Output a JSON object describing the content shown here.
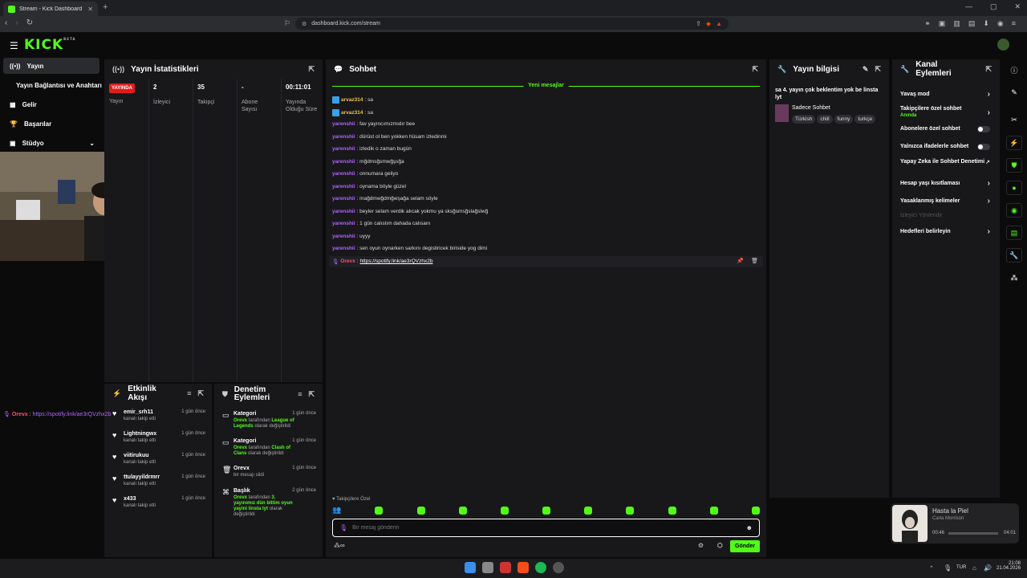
{
  "browser": {
    "tab_title": "Stream - Kick Dashboard",
    "url": "dashboard.kick.com/stream"
  },
  "brand": {
    "logo": "KICK",
    "badge": "BETA",
    "accent": "#53fc18"
  },
  "nav": {
    "items": [
      {
        "label": "Yayın",
        "icon": "broadcast-icon"
      },
      {
        "label": "Yayın Bağlantısı ve Anahtarı",
        "icon": ""
      },
      {
        "label": "Gelir",
        "icon": "revenue-icon"
      },
      {
        "label": "Başarılar",
        "icon": "trophy-icon"
      },
      {
        "label": "Stüdyo",
        "icon": "studio-icon"
      }
    ]
  },
  "stats": {
    "title": "Yayın İstatistikleri",
    "badge": "YAYINDA",
    "cols": [
      {
        "value": "",
        "label": "Yayın"
      },
      {
        "value": "2",
        "label": "İzleyici"
      },
      {
        "value": "35",
        "label": "Takipçi"
      },
      {
        "value": "-",
        "label": "Abone Sayısı"
      },
      {
        "value": "00:11:01",
        "label": "Yayında Olduğu Süre"
      }
    ]
  },
  "chat": {
    "title": "Sohbet",
    "new_messages": "Yeni mesajlar",
    "messages": [
      {
        "user": "arvaz314",
        "text": ": sa"
      },
      {
        "user": "arvaz314",
        "text": ": sa"
      },
      {
        "user": "yarenshii",
        "text": ": fav yayıncımızmıdır bee"
      },
      {
        "user": "yarenshii",
        "text": ": dürüst ol ben yokken hüsam izledinmi"
      },
      {
        "user": "yarenshii",
        "text": ": izledik o zaman bugün"
      },
      {
        "user": "yarenshii",
        "text": ": mğdmsğsmwğşsğa"
      },
      {
        "user": "yarenshii",
        "text": ": onnumara geliyo"
      },
      {
        "user": "yarenshii",
        "text": ": oynama böyle güzel"
      },
      {
        "user": "yarenshii",
        "text": ": mağdmwğdmğwşağa selam söyle"
      },
      {
        "user": "yarenshii",
        "text": ": beyler selam verdik alıcak yokmu ya sksğsmsğslağslwğ"
      },
      {
        "user": "yarenshii",
        "text": ": 1 gün calıstım dahada calısanı"
      },
      {
        "user": "yarenshii",
        "text": ": uyyy"
      },
      {
        "user": "yarenshii",
        "text": ": sen oyun oynarken sarkını degistiricek biriside yog dimi"
      },
      {
        "user": "Orevx",
        "text": ": ",
        "link": "https://spotify.link/ae3rQVzhx2b"
      }
    ],
    "followers_only": "Takipçilere Özel",
    "input_placeholder": "Bir mesaj gönderin",
    "send": "Gönder"
  },
  "info": {
    "title": "Yayın bilgisi",
    "stream_title": "sa 4. yayın çok beklentim yok be linsta lyt",
    "category": "Sadece Sohbet",
    "tags": [
      "Türkish",
      "chill",
      "funny",
      "turkçe"
    ]
  },
  "actions": {
    "title": "Kanal Eylemleri",
    "items": [
      {
        "label": "Yavaş mod"
      },
      {
        "label": "Takipçilere özel sohbet",
        "sub": "Anında"
      },
      {
        "label": "Abonelere özel sohbet"
      },
      {
        "label": "Yalnızca ifadelerle sohbet"
      },
      {
        "label": "Yapay Zeka ile Sohbet Denetimi"
      },
      {
        "label": "Hesap yaşı kısıtlaması"
      },
      {
        "label": "Yasaklanmış kelimeler"
      },
      {
        "label": "İzleyici Yönlendir"
      },
      {
        "label": "Hedefleri belirleyin"
      }
    ]
  },
  "activity": {
    "title": "Etkinlik Akışı",
    "items": [
      {
        "name": "emir_srh11",
        "sub": "kanalı takip etti",
        "time": "1 gün önce"
      },
      {
        "name": "Lightningwx",
        "sub": "kanalı takip etti",
        "time": "1 gün önce"
      },
      {
        "name": "viitirukuu",
        "sub": "kanalı takip etti",
        "time": "1 gün önce"
      },
      {
        "name": "ttulayyildrmrr",
        "sub": "kanalı takip etti",
        "time": "1 gün önce"
      },
      {
        "name": "x433",
        "sub": "kanalı takip etti",
        "time": "1 gün önce"
      }
    ]
  },
  "moderation": {
    "title": "Denetim Eylemleri",
    "items": [
      {
        "name": "Kategori",
        "actor": "Orevx",
        "mid": " tarafından ",
        "target": "League of Legends",
        "tail": " olarak değiştirildi",
        "time": "1 gün önce"
      },
      {
        "name": "Kategori",
        "actor": "Orevx",
        "mid": " tarafından ",
        "target": "Clash of Clans",
        "tail": " olarak değiştirildi",
        "time": "1 gün önce"
      },
      {
        "name": "Orevx",
        "actor": "",
        "mid": "bir mesajı sildi",
        "target": "",
        "tail": "",
        "time": "1 gün önce"
      },
      {
        "name": "Başlık",
        "actor": "Orevx",
        "mid": " tarafından ",
        "target": "3. yayınımız dün bittim oyun yayini linsta lyt",
        "tail": " olarak değiştirildi",
        "time": "2 gün önce"
      }
    ]
  },
  "overlay": {
    "user": "Orevx",
    "sep": " : ",
    "text": "https://spotify.link/ae3rQVzhx2b"
  },
  "music": {
    "title": "Hasta la Piel",
    "artist": "Carla Morrison",
    "elapsed": "00:46",
    "total": "04:01"
  },
  "taskbar": {
    "lang": "TUR",
    "time": "21:08",
    "date": "21.04.2026"
  }
}
